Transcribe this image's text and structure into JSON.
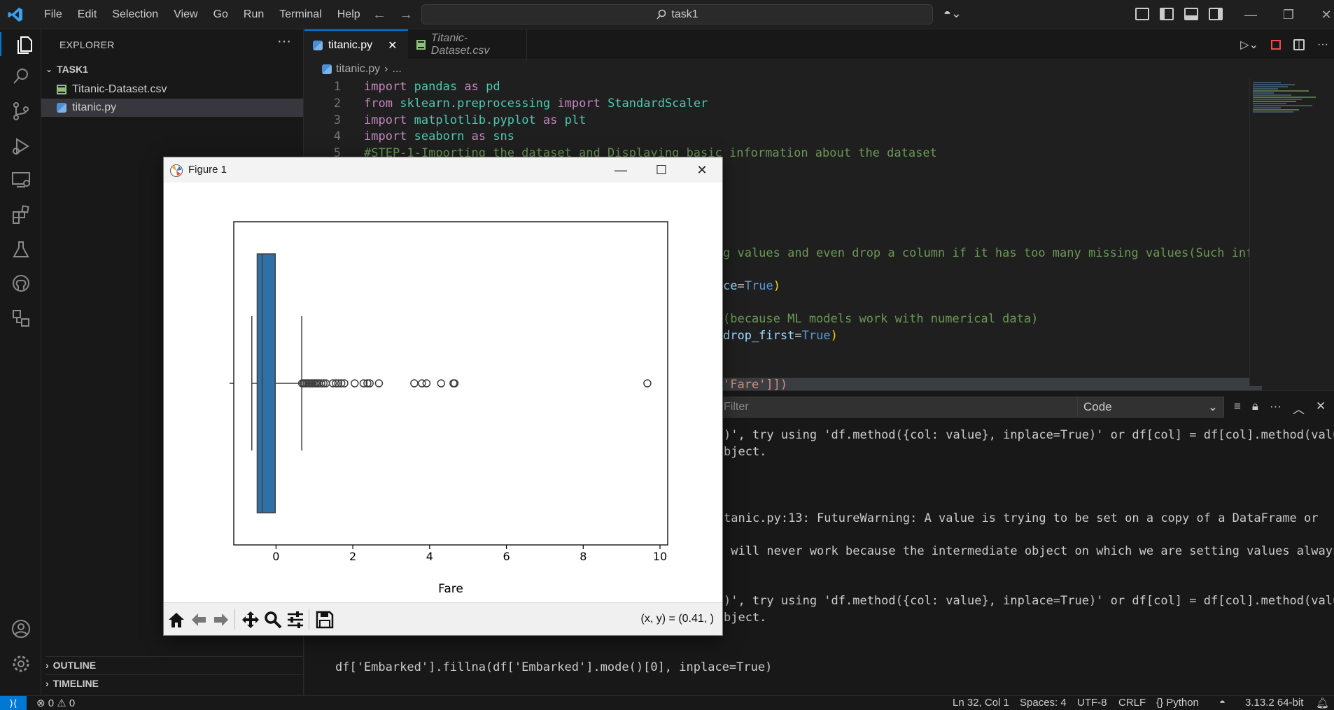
{
  "titlebar": {
    "menu": [
      "File",
      "Edit",
      "Selection",
      "View",
      "Go",
      "Run",
      "Terminal",
      "Help"
    ],
    "search": "task1"
  },
  "sidebar": {
    "title": "EXPLORER",
    "folder": "TASK1",
    "files": [
      "Titanic-Dataset.csv",
      "titanic.py"
    ],
    "outline": "OUTLINE",
    "timeline": "TIMELINE"
  },
  "tabs": {
    "active": "titanic.py",
    "inactive": "Titanic-Dataset.csv"
  },
  "breadcrumb": {
    "file": "titanic.py",
    "sep": "›",
    "rest": "..."
  },
  "code": {
    "line_numbers": [
      "1",
      "2",
      "3",
      "4",
      "5"
    ],
    "l1": {
      "kw": "import",
      "mod": "pandas",
      "as": "as",
      "alias": "pd"
    },
    "l2": {
      "from": "from",
      "mod": "sklearn.preprocessing",
      "imp": "import",
      "cls": "StandardScaler"
    },
    "l3": {
      "kw": "import",
      "mod": "matplotlib.pyplot",
      "as": "as",
      "alias": "plt"
    },
    "l4": {
      "kw": "import",
      "mod": "seaborn",
      "as": "as",
      "alias": "sns"
    },
    "l5": "#STEP-1-Importing the dataset and Displaying basic information about the dataset",
    "partial1": "g values and even drop a column if it has too many missing values(Such info wa",
    "partial2_a": "ce",
    "partial2_b": "=",
    "partial2_c": "True",
    "partial2_d": ")",
    "partial3": "(because ML models work with numerical data)",
    "partial4_a": "drop_first",
    "partial4_b": "=",
    "partial4_c": "True",
    "partial4_d": ")",
    "partial5": "'Fare']])"
  },
  "panel": {
    "filter_placeholder": "Filter",
    "channel": "Code",
    "lines": [
      ")', try using 'df.method({col: value}, inplace=True)' or df[col] = df[col].method(value)",
      "bject.",
      "tanic.py:13: FutureWarning: A value is trying to be set on a copy of a DataFrame or",
      " will never work because the intermediate object on which we are setting values always",
      ")', try using 'df.method({col: value}, inplace=True)' or df[col] = df[col].method(value)",
      "bject.",
      "df['Embarked'].fillna(df['Embarked'].mode()[0], inplace=True)"
    ]
  },
  "status": {
    "errors": "0",
    "warnings": "0",
    "position": "Ln 32, Col 1",
    "spaces": "Spaces: 4",
    "encoding": "UTF-8",
    "eol": "CRLF",
    "language": "Python",
    "interpreter": "3.13.2 64-bit"
  },
  "figure": {
    "title": "Figure 1",
    "coords": "(x, y) = (0.41, )"
  },
  "chart_data": {
    "type": "box",
    "xlabel": "Fare",
    "xticks": [
      0,
      2,
      4,
      6,
      8,
      10
    ],
    "xlim": [
      -1.1,
      10.2
    ],
    "box": {
      "whisker_low": -0.63,
      "q1": -0.49,
      "median": -0.36,
      "q3": -0.02,
      "whisker_high": 0.67
    },
    "outliers": [
      0.68,
      0.72,
      0.76,
      0.8,
      0.84,
      0.88,
      0.92,
      0.96,
      1.0,
      1.04,
      1.08,
      1.12,
      1.18,
      1.24,
      1.3,
      1.48,
      1.56,
      1.62,
      1.7,
      1.78,
      2.05,
      2.28,
      2.38,
      2.44,
      2.68,
      3.6,
      3.8,
      3.92,
      4.3,
      4.62,
      4.65,
      9.67
    ],
    "color": "#2f71a6"
  }
}
